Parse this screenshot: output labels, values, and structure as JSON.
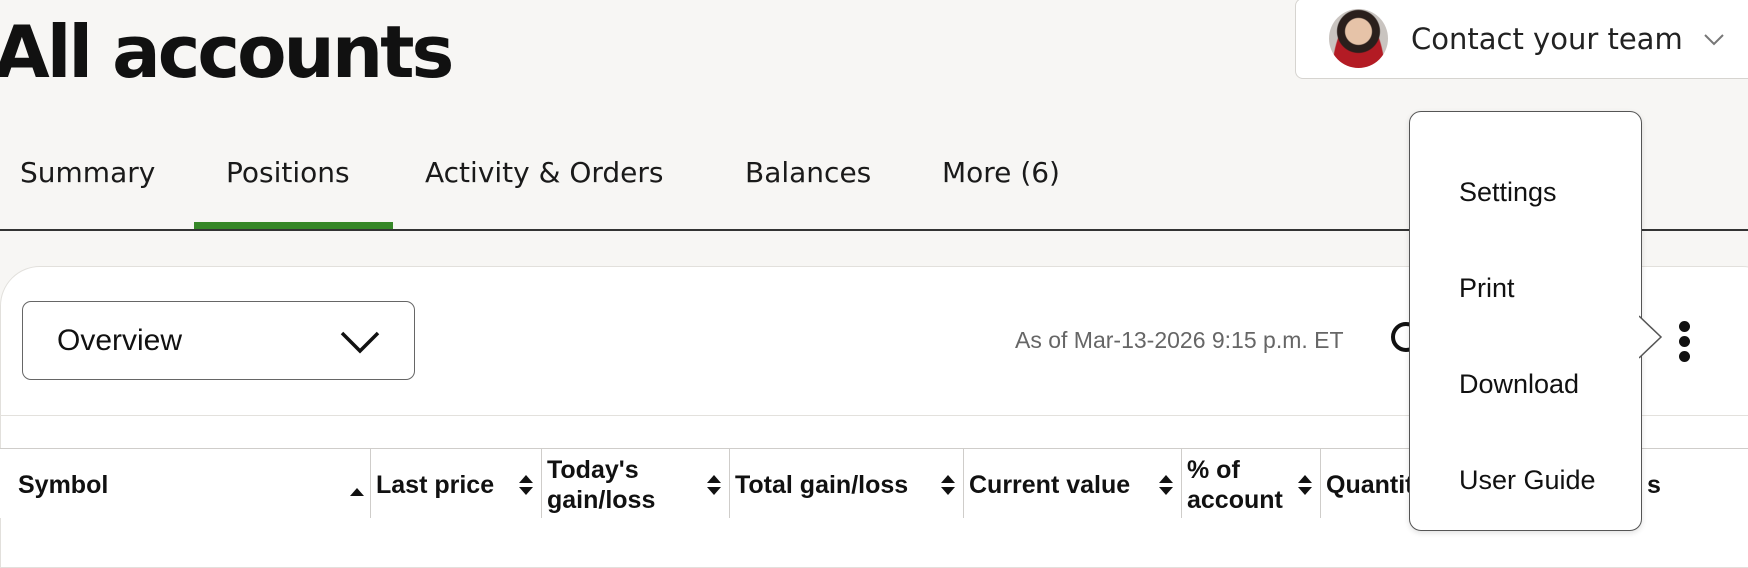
{
  "page": {
    "title": "All accounts"
  },
  "contact": {
    "label": "Contact your team"
  },
  "tabs": [
    {
      "label": "Summary"
    },
    {
      "label": "Positions"
    },
    {
      "label": "Activity & Orders"
    },
    {
      "label": "Balances"
    },
    {
      "label": "More (6)"
    }
  ],
  "active_tab": "Positions",
  "toolbar": {
    "view_select": "Overview",
    "as_of": "As of Mar-13-2026 9:15 p.m. ET"
  },
  "table": {
    "columns": [
      {
        "line1": "Symbol",
        "line2": ""
      },
      {
        "line1": "Last price",
        "line2": ""
      },
      {
        "line1": "Today's",
        "line2": "gain/loss"
      },
      {
        "line1": "Total gain/loss",
        "line2": ""
      },
      {
        "line1": "Current value",
        "line2": ""
      },
      {
        "line1": "% of",
        "line2": "account"
      },
      {
        "line1": "Quantit",
        "line2": ""
      },
      {
        "line1": "s",
        "line2": ""
      }
    ],
    "sort": {
      "column": "Symbol",
      "direction": "ascending"
    }
  },
  "menu": {
    "items": [
      {
        "label": "Settings"
      },
      {
        "label": "Print"
      },
      {
        "label": "Download"
      },
      {
        "label": "User Guide"
      }
    ]
  },
  "colors": {
    "accent": "#368727",
    "background": "#f7f6f4",
    "text": "#111111"
  },
  "icons": {
    "contact_chevron": "chevron-down-icon",
    "select_chevron": "chevron-down-icon",
    "refresh": "refresh-icon",
    "more": "kebab-menu-icon",
    "sort": "sort-icon"
  }
}
